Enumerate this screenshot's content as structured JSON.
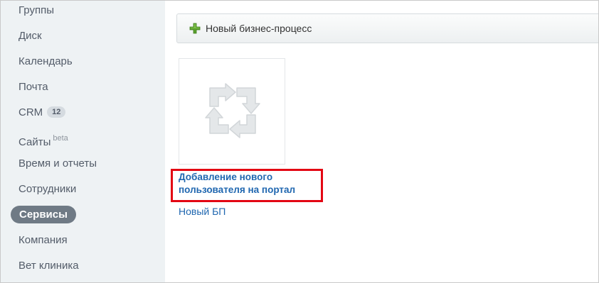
{
  "sidebar": {
    "items": [
      {
        "label": "Группы"
      },
      {
        "label": "Диск"
      },
      {
        "label": "Календарь"
      },
      {
        "label": "Почта"
      },
      {
        "label": "CRM",
        "count": "12"
      },
      {
        "label": "Сайты",
        "badge": "beta"
      },
      {
        "label": "Время и отчеты"
      },
      {
        "label": "Сотрудники"
      },
      {
        "label": "Сервисы",
        "active": true
      },
      {
        "label": "Компания"
      },
      {
        "label": "Вет клиника"
      }
    ]
  },
  "toolbar": {
    "new_bp_label": "Новый бизнес-процесс",
    "new_bp_icon": "plus-icon"
  },
  "card": {
    "thumbnail_icon": "recycle-arrows-icon",
    "title": "Добавление нового пользователя на портал",
    "link": "Новый БП"
  },
  "colors": {
    "sidebar_bg": "#eef2f4",
    "active_item_bg": "#6f7a85",
    "link": "#2067b0",
    "highlight": "#e30613",
    "plus": "#5aa02c"
  }
}
